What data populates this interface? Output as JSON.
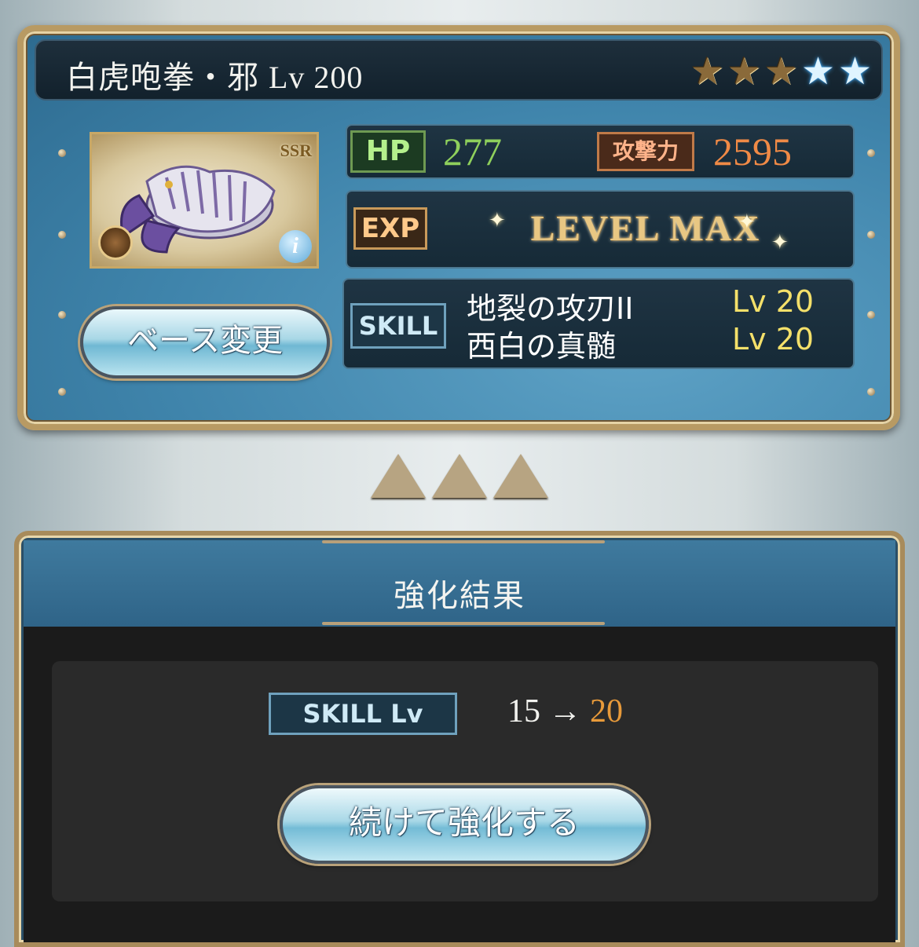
{
  "weapon": {
    "name": "白虎咆拳・邪",
    "level": "Lv 200",
    "stars": [
      "gold",
      "gold",
      "gold",
      "blue",
      "blue"
    ],
    "rarity": "SSR",
    "info_glyph": "i"
  },
  "stats": {
    "hp_label": "HP",
    "hp_value": "277",
    "atk_label": "攻撃力",
    "atk_value": "2595",
    "exp_label": "EXP",
    "exp_status": "LEVEL MAX"
  },
  "skills": {
    "label": "SKILL",
    "items": [
      {
        "name": "地裂の攻刃II",
        "level": "Lv 20"
      },
      {
        "name": "西白の真髄",
        "level": "Lv 20"
      }
    ]
  },
  "buttons": {
    "base_change": "ベース変更",
    "continue": "続けて強化する"
  },
  "result": {
    "title": "強化結果",
    "skill_lv_label": "SKILL Lv",
    "from": "15",
    "arrow": "→",
    "to": "20"
  },
  "colors": {
    "hp": "#8fd05c",
    "atk": "#f08a46",
    "skill_lv": "#f4e06a",
    "result_new": "#e89a3a"
  }
}
